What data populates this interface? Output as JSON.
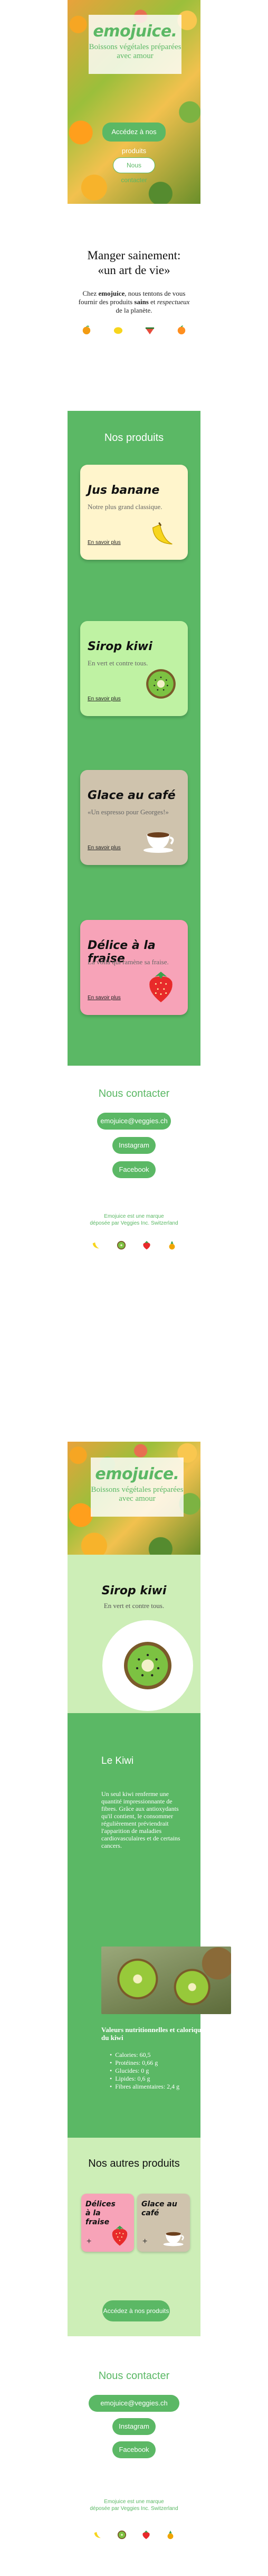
{
  "brand": {
    "name": "emojuice.",
    "tagline": "Boissons végétales préparées avec amour",
    "color": "#5bb865",
    "light": "#cdeeb7"
  },
  "hero": {
    "cta_products": "Accédez à nos produits",
    "cta_contact": "Nous contacter"
  },
  "intro": {
    "title_line1": "Manger sainement:",
    "title_line2": "«un art de vie»",
    "text_pre": "Chez ",
    "text_brand": "emojuice",
    "text_mid": ", nous tentons de vous fournir des produits ",
    "text_bold": "sains",
    "text_and": " et ",
    "text_italic": "respectueux",
    "text_post": " de la planète."
  },
  "products": {
    "title": "Nos produits",
    "link_label": "En savoir plus",
    "items": [
      {
        "name": "Jus banane",
        "desc": "Notre plus grand classique.",
        "bg": "#fff5cc",
        "icon": "banana-icon"
      },
      {
        "name": "Sirop kiwi",
        "desc": "En vert et contre tous.",
        "bg": "#bff2a3",
        "icon": "kiwi-icon"
      },
      {
        "name": "Glace au café",
        "desc": "«Un espresso pour Georges!»",
        "bg": "#cfc3ad",
        "icon": "coffee-icon"
      },
      {
        "name": "Délice à la fraise",
        "desc": "La vollà qui ramène sa fraise.",
        "bg": "#f7a3b8",
        "icon": "strawberry-icon"
      }
    ]
  },
  "contact": {
    "title": "Nous contacter",
    "email": "emojuice@veggies.ch",
    "instagram": "Instagram",
    "facebook": "Facebook"
  },
  "footer": {
    "line1": "Emojuice est une marque",
    "line2": "déposée par Veggies Inc. Switzerland"
  },
  "detail": {
    "product_name": "Sirop kiwi",
    "product_desc": "En vert et contre tous.",
    "section_title": "Le Kiwi",
    "section_text": "Un seul kiwi renferme une quantité impressionnante de fibres. Grâce aux antioxydants qu'il contient, le consommer régulièrement préviendrait l'apparition de maladies cardiovasculaires et de certains cancers.",
    "nutrition_title": "Valeurs nutritionnelles et caloriques du kiwi",
    "nutrition": [
      "Calories: 60,5",
      "Protéines: 0,66 g",
      "Glucides: 0 g",
      "Lipides: 0,6 g",
      "Fibres alimentaires: 2,4 g"
    ],
    "others_title": "Nos autres produits",
    "others": [
      {
        "name": "Délices à la fraise",
        "bg": "#f7a3b8",
        "icon": "strawberry-icon"
      },
      {
        "name": "Glace au café",
        "bg": "#cfc3ad",
        "icon": "coffee-icon"
      }
    ],
    "cta_products": "Accédez à nos produits"
  }
}
